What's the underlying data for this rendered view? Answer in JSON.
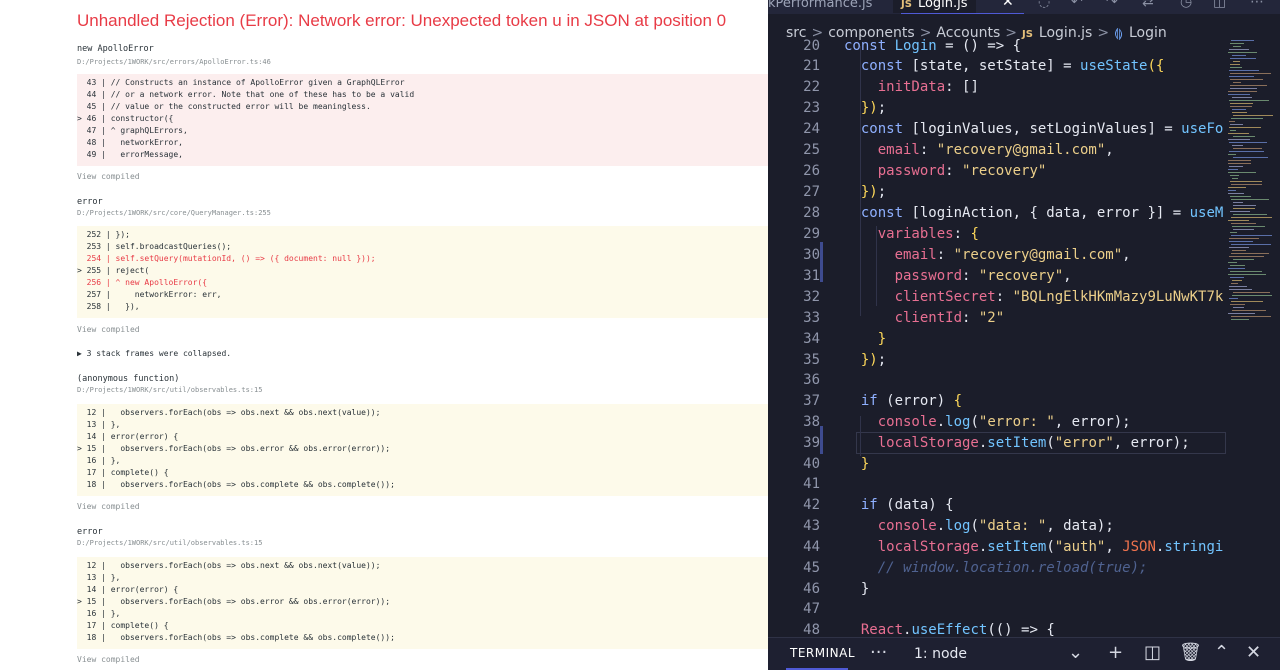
{
  "overlay": {
    "title": "Unhandled Rejection (Error): Network error: Unexpected token u in JSON at position 0",
    "view_compiled": "View compiled",
    "collapsed": "▶ 3 stack frames were collapsed.",
    "frames": [
      {
        "name": "new ApolloError",
        "path": "D:/Projects/1WORK/src/errors/ApolloError.ts:46",
        "lines": [
          "  43 | // Constructs an instance of ApolloError given a GraphQLError",
          "  44 | // or a network error. Note that one of these has to be a valid",
          "  45 | // value or the constructed error will be meaningless.",
          "> 46 | constructor({",
          "  47 | ^ graphQLErrors,",
          "  48 |   networkError,",
          "  49 |   errorMessage,"
        ]
      },
      {
        "name": "error",
        "path": "D:/Projects/1WORK/src/core/QueryManager.ts:255",
        "lines": [
          "  252 | });",
          "  253 | self.broadcastQueries();",
          "  254 | self.setQuery(mutationId, () => ({ document: null }));",
          "> 255 | reject(",
          "  256 | ^ new ApolloError({",
          "  257 |     networkError: err,",
          "  258 |   }),"
        ]
      },
      {
        "name": "(anonymous function)",
        "path": "D:/Projects/1WORK/src/util/observables.ts:15",
        "lines": [
          "  12 |   observers.forEach(obs => obs.next && obs.next(value));",
          "  13 | },",
          "  14 | error(error) {",
          "> 15 |   observers.forEach(obs => obs.error && obs.error(error));",
          "  16 | },",
          "  17 | complete() {",
          "  18 |   observers.forEach(obs => obs.complete && obs.complete());"
        ]
      },
      {
        "name": "error",
        "path": "D:/Projects/1WORK/src/util/observables.ts:15",
        "lines": [
          "  12 |   observers.forEach(obs => obs.next && obs.next(value));",
          "  13 | },",
          "  14 | error(error) {",
          "> 15 |   observers.forEach(obs => obs.error && obs.error(error));",
          "  16 | },",
          "  17 | complete() {",
          "  18 |   observers.forEach(obs => obs.complete && obs.complete());"
        ]
      }
    ]
  },
  "editor": {
    "tabs": {
      "prev": "kPerformance.js",
      "active": "Login.js",
      "js_badge": "JS"
    },
    "breadcrumb": {
      "items": [
        "src",
        "components",
        "Accounts",
        "Login.js",
        "Login"
      ],
      "separator": ">"
    },
    "line_numbers": [
      "20",
      "21",
      "22",
      "23",
      "24",
      "25",
      "26",
      "27",
      "28",
      "29",
      "30",
      "31",
      "32",
      "33",
      "34",
      "35",
      "36",
      "37",
      "38",
      "39",
      "40",
      "41",
      "42",
      "43",
      "44",
      "45",
      "46",
      "47",
      "48"
    ],
    "code": {
      "l20": "const Login = () => {",
      "l21": "  const [state, setState] = useState({",
      "l22": "    initData: []",
      "l23": "  });",
      "l24": "  const [loginValues, setLoginValues] = useFo",
      "l25": "    email: \"recovery@gmail.com\",",
      "l26": "    password: \"recovery\"",
      "l27": "  });",
      "l28": "  const [loginAction, { data, error }] = useM",
      "l29": "    variables: {",
      "l30": "      email: \"recovery@gmail.com\",",
      "l31": "      password: \"recovery\",",
      "l32": "      clientSecret: \"BQLngElkHKmMazy9LuNwKT7k",
      "l33": "      clientId: \"2\"",
      "l34": "    }",
      "l35": "  });",
      "l37": "  if (error) {",
      "l38": "    console.log(\"error: \", error);",
      "l39": "    localStorage.setItem(\"error\", error);",
      "l40": "  }",
      "l42": "  if (data) {",
      "l43": "    console.log(\"data: \", data);",
      "l44": "    localStorage.setItem(\"auth\", JSON.stringi",
      "l45": "    // window.location.reload(true);",
      "l46": "  }",
      "l48": "  React.useEffect(() => {"
    },
    "terminal": {
      "label": "TERMINAL",
      "more": "···",
      "selected": "1: node"
    },
    "colors": {
      "background": "#1b1d2a",
      "accent": "#4f5ad6",
      "error_title": "#e83b46"
    }
  }
}
